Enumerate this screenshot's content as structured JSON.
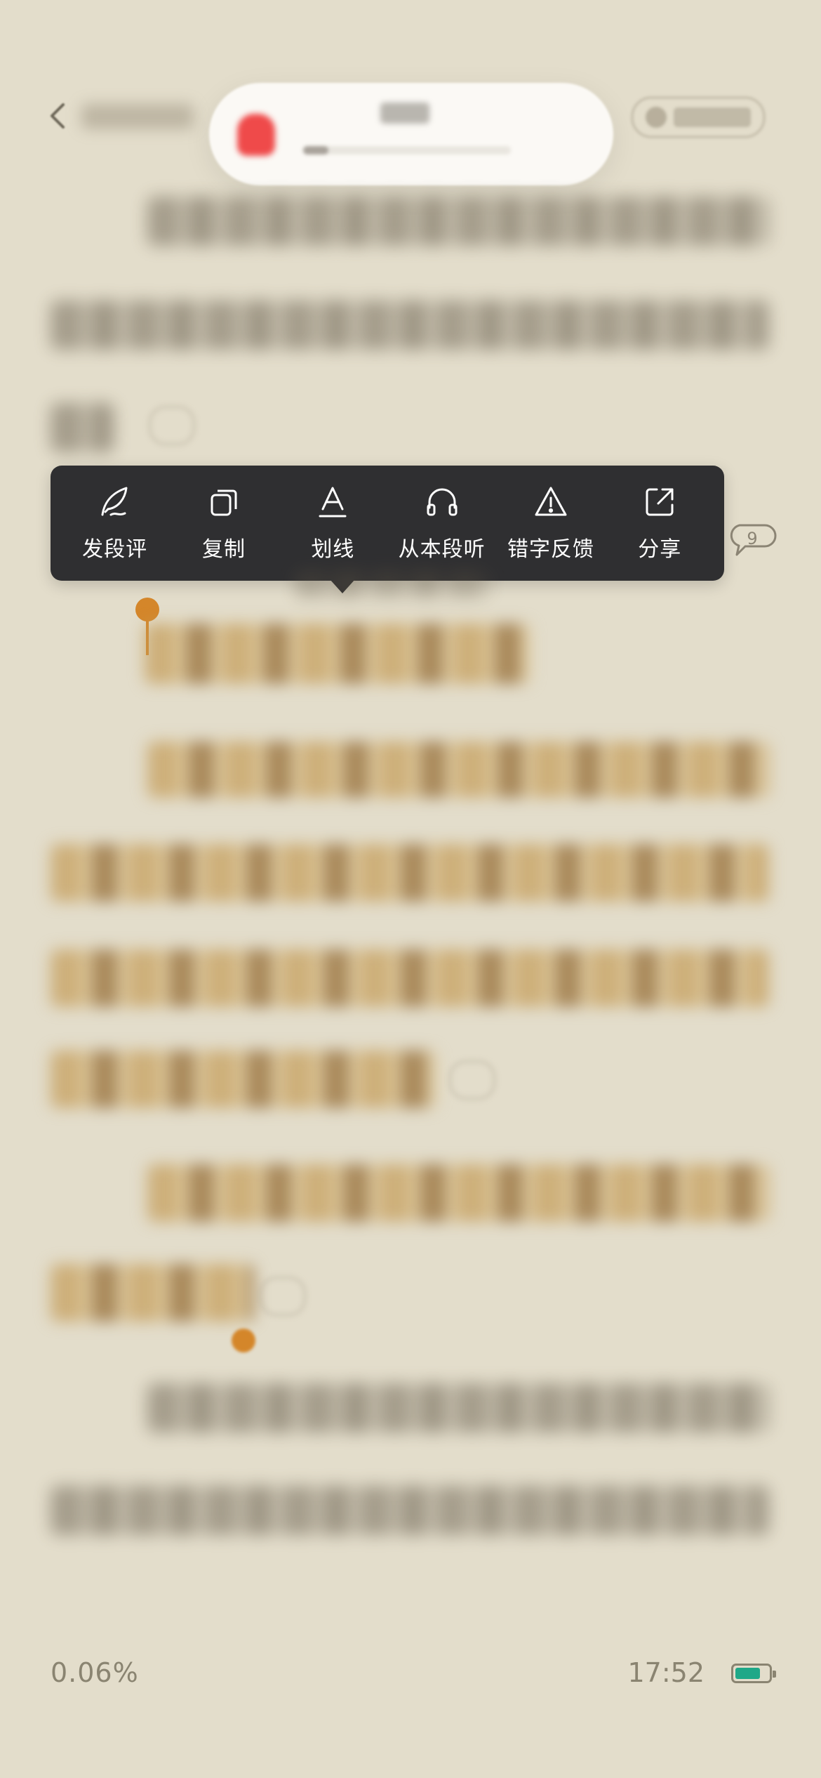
{
  "menu": {
    "items": [
      {
        "label": "发段评",
        "icon": "quill-icon"
      },
      {
        "label": "复制",
        "icon": "copy-icon"
      },
      {
        "label": "划线",
        "icon": "underline-icon"
      },
      {
        "label": "从本段听",
        "icon": "headphones-icon"
      },
      {
        "label": "错字反馈",
        "icon": "warning-icon"
      },
      {
        "label": "分享",
        "icon": "share-icon"
      }
    ]
  },
  "paragraph_comment": {
    "count": "9"
  },
  "audio_player": {
    "progress_fraction": 0.12
  },
  "status": {
    "reading_progress": "0.06%",
    "time": "17:52",
    "battery_level": 0.75
  },
  "colors": {
    "page_background": "#e3ddcb",
    "menu_background": "#2f2f31",
    "selection_handle": "#d4862a",
    "highlight": "#c49c58",
    "battery": "#1fa888",
    "status_text": "#8a8471"
  }
}
